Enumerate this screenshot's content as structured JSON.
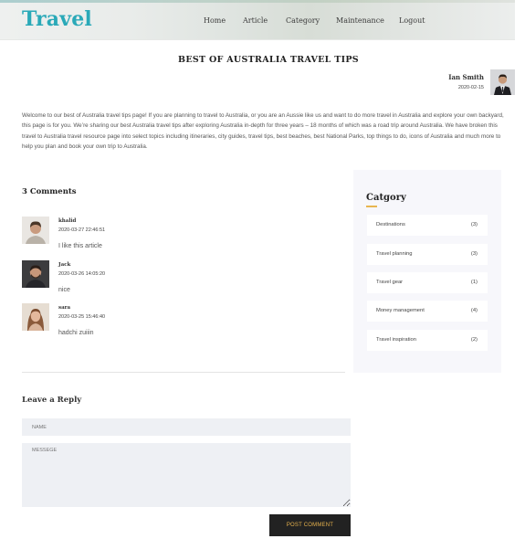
{
  "header": {
    "logo": "Travel",
    "nav": [
      {
        "label": "Home"
      },
      {
        "label": "Article"
      },
      {
        "label": "Category"
      },
      {
        "label": "Maintenance"
      },
      {
        "label": "Logout"
      }
    ]
  },
  "post": {
    "title": "BEST OF AUSTRALIA TRAVEL TIPS",
    "author": {
      "name": "Ian Smith",
      "date": "2020-02-15"
    },
    "intro": "Welcome to our best of Australia travel tips page! If you are planning to travel to Australia, or you are an Aussie like us and want to do more travel in Australia and explore your own backyard, this page is for you. We’re sharing our best Australia travel tips after exploring Australia in-depth for three years – 18 months of which was a road trip around Australia. We have broken this travel to Australia travel resource page into select topics including itineraries, city guides, travel tips, best beaches, best National Parks, top things to do, icons of Australia and much more to help you plan and book your own trip to Australia."
  },
  "comments": {
    "title": "3 Comments",
    "items": [
      {
        "name": "khalid",
        "date": "2020-03-27 22:46:51",
        "text": "I like this article"
      },
      {
        "name": "Jack",
        "date": "2020-03-26 14:05:20",
        "text": "nice"
      },
      {
        "name": "sara",
        "date": "2020-03-25 15:46:40",
        "text": "hadchi zuiiin"
      }
    ]
  },
  "sidebar": {
    "title": "Catgory",
    "categories": [
      {
        "label": "Destinations",
        "count": "(3)"
      },
      {
        "label": "Travel planning",
        "count": "(3)"
      },
      {
        "label": "Travel gear",
        "count": "(1)"
      },
      {
        "label": "Money management",
        "count": "(4)"
      },
      {
        "label": "Travel inspiration",
        "count": "(2)"
      }
    ]
  },
  "reply": {
    "title": "Leave a Reply",
    "name_placeholder": "NAME",
    "message_placeholder": "MESSEGE",
    "button_label": "POST COMMENT"
  }
}
